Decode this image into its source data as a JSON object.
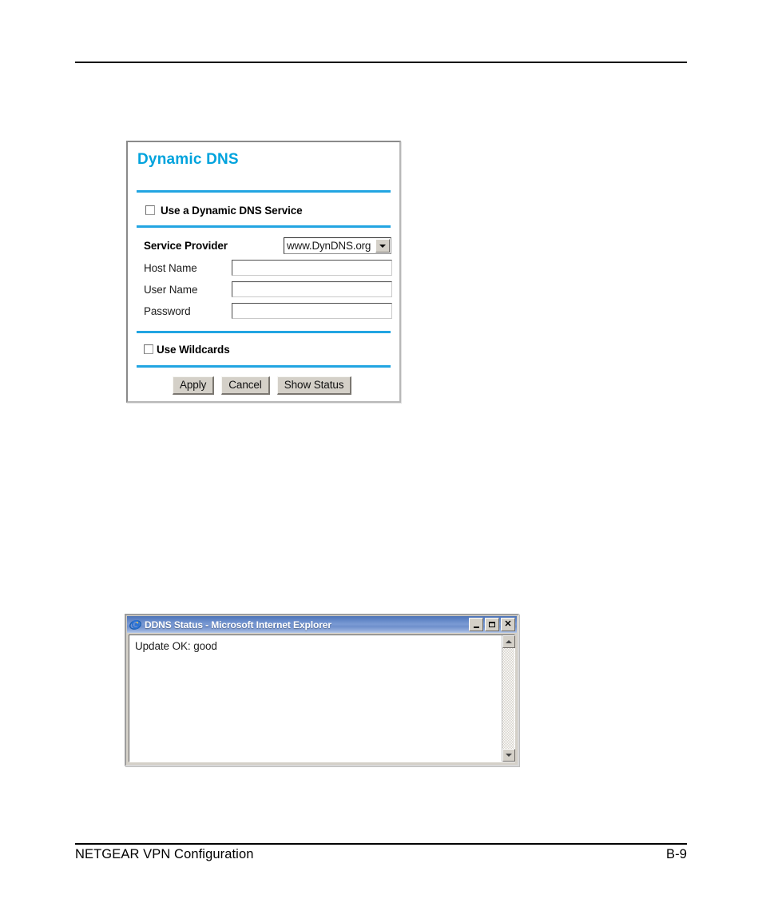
{
  "page": {
    "footer_left": "NETGEAR VPN Configuration",
    "footer_right": "B-9"
  },
  "ddns_panel": {
    "title": "Dynamic DNS",
    "use_service_checkbox": {
      "label": "Use a Dynamic DNS Service",
      "checked": false
    },
    "service_provider": {
      "label": "Service Provider",
      "selected": "www.DynDNS.org",
      "options": [
        "www.DynDNS.org"
      ]
    },
    "fields": [
      {
        "label": "Host Name",
        "value": "",
        "placeholder": ""
      },
      {
        "label": "User Name",
        "value": "",
        "placeholder": ""
      },
      {
        "label": "Password",
        "value": "",
        "placeholder": ""
      }
    ],
    "use_wildcards_checkbox": {
      "label": "Use Wildcards",
      "checked": false
    },
    "buttons": [
      {
        "label": "Apply"
      },
      {
        "label": "Cancel"
      },
      {
        "label": "Show Status"
      }
    ],
    "colors": {
      "title": "#00a3dd",
      "divider": "#22a5e2",
      "button_face": "#d4d0c8"
    }
  },
  "ie_window": {
    "title": "DDNS Status - Microsoft Internet Explorer",
    "icon": "internet-explorer-icon",
    "controls": {
      "minimize": "_",
      "maximize": "□",
      "close": "✕"
    },
    "document_text": "Update OK: good",
    "scrollbar": {
      "up_arrow": "▲",
      "down_arrow": "▼"
    },
    "colors": {
      "titlebar_start": "#4e73b5",
      "titlebar_end": "#b8cbe9",
      "client_bg": "#ffffff"
    }
  }
}
